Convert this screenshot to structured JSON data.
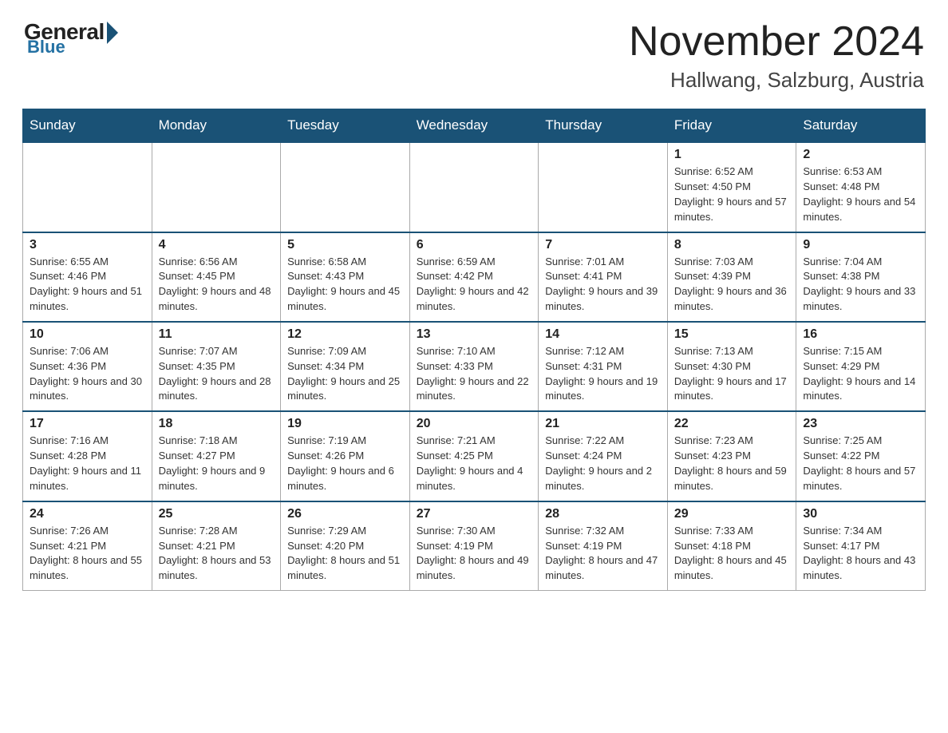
{
  "header": {
    "logo_general": "General",
    "logo_blue": "Blue",
    "main_title": "November 2024",
    "subtitle": "Hallwang, Salzburg, Austria"
  },
  "weekdays": [
    "Sunday",
    "Monday",
    "Tuesday",
    "Wednesday",
    "Thursday",
    "Friday",
    "Saturday"
  ],
  "weeks": [
    [
      {
        "day": "",
        "info": "",
        "empty": true
      },
      {
        "day": "",
        "info": "",
        "empty": true
      },
      {
        "day": "",
        "info": "",
        "empty": true
      },
      {
        "day": "",
        "info": "",
        "empty": true
      },
      {
        "day": "",
        "info": "",
        "empty": true
      },
      {
        "day": "1",
        "info": "Sunrise: 6:52 AM\nSunset: 4:50 PM\nDaylight: 9 hours and 57 minutes."
      },
      {
        "day": "2",
        "info": "Sunrise: 6:53 AM\nSunset: 4:48 PM\nDaylight: 9 hours and 54 minutes."
      }
    ],
    [
      {
        "day": "3",
        "info": "Sunrise: 6:55 AM\nSunset: 4:46 PM\nDaylight: 9 hours and 51 minutes."
      },
      {
        "day": "4",
        "info": "Sunrise: 6:56 AM\nSunset: 4:45 PM\nDaylight: 9 hours and 48 minutes."
      },
      {
        "day": "5",
        "info": "Sunrise: 6:58 AM\nSunset: 4:43 PM\nDaylight: 9 hours and 45 minutes."
      },
      {
        "day": "6",
        "info": "Sunrise: 6:59 AM\nSunset: 4:42 PM\nDaylight: 9 hours and 42 minutes."
      },
      {
        "day": "7",
        "info": "Sunrise: 7:01 AM\nSunset: 4:41 PM\nDaylight: 9 hours and 39 minutes."
      },
      {
        "day": "8",
        "info": "Sunrise: 7:03 AM\nSunset: 4:39 PM\nDaylight: 9 hours and 36 minutes."
      },
      {
        "day": "9",
        "info": "Sunrise: 7:04 AM\nSunset: 4:38 PM\nDaylight: 9 hours and 33 minutes."
      }
    ],
    [
      {
        "day": "10",
        "info": "Sunrise: 7:06 AM\nSunset: 4:36 PM\nDaylight: 9 hours and 30 minutes."
      },
      {
        "day": "11",
        "info": "Sunrise: 7:07 AM\nSunset: 4:35 PM\nDaylight: 9 hours and 28 minutes."
      },
      {
        "day": "12",
        "info": "Sunrise: 7:09 AM\nSunset: 4:34 PM\nDaylight: 9 hours and 25 minutes."
      },
      {
        "day": "13",
        "info": "Sunrise: 7:10 AM\nSunset: 4:33 PM\nDaylight: 9 hours and 22 minutes."
      },
      {
        "day": "14",
        "info": "Sunrise: 7:12 AM\nSunset: 4:31 PM\nDaylight: 9 hours and 19 minutes."
      },
      {
        "day": "15",
        "info": "Sunrise: 7:13 AM\nSunset: 4:30 PM\nDaylight: 9 hours and 17 minutes."
      },
      {
        "day": "16",
        "info": "Sunrise: 7:15 AM\nSunset: 4:29 PM\nDaylight: 9 hours and 14 minutes."
      }
    ],
    [
      {
        "day": "17",
        "info": "Sunrise: 7:16 AM\nSunset: 4:28 PM\nDaylight: 9 hours and 11 minutes."
      },
      {
        "day": "18",
        "info": "Sunrise: 7:18 AM\nSunset: 4:27 PM\nDaylight: 9 hours and 9 minutes."
      },
      {
        "day": "19",
        "info": "Sunrise: 7:19 AM\nSunset: 4:26 PM\nDaylight: 9 hours and 6 minutes."
      },
      {
        "day": "20",
        "info": "Sunrise: 7:21 AM\nSunset: 4:25 PM\nDaylight: 9 hours and 4 minutes."
      },
      {
        "day": "21",
        "info": "Sunrise: 7:22 AM\nSunset: 4:24 PM\nDaylight: 9 hours and 2 minutes."
      },
      {
        "day": "22",
        "info": "Sunrise: 7:23 AM\nSunset: 4:23 PM\nDaylight: 8 hours and 59 minutes."
      },
      {
        "day": "23",
        "info": "Sunrise: 7:25 AM\nSunset: 4:22 PM\nDaylight: 8 hours and 57 minutes."
      }
    ],
    [
      {
        "day": "24",
        "info": "Sunrise: 7:26 AM\nSunset: 4:21 PM\nDaylight: 8 hours and 55 minutes."
      },
      {
        "day": "25",
        "info": "Sunrise: 7:28 AM\nSunset: 4:21 PM\nDaylight: 8 hours and 53 minutes."
      },
      {
        "day": "26",
        "info": "Sunrise: 7:29 AM\nSunset: 4:20 PM\nDaylight: 8 hours and 51 minutes."
      },
      {
        "day": "27",
        "info": "Sunrise: 7:30 AM\nSunset: 4:19 PM\nDaylight: 8 hours and 49 minutes."
      },
      {
        "day": "28",
        "info": "Sunrise: 7:32 AM\nSunset: 4:19 PM\nDaylight: 8 hours and 47 minutes."
      },
      {
        "day": "29",
        "info": "Sunrise: 7:33 AM\nSunset: 4:18 PM\nDaylight: 8 hours and 45 minutes."
      },
      {
        "day": "30",
        "info": "Sunrise: 7:34 AM\nSunset: 4:17 PM\nDaylight: 8 hours and 43 minutes."
      }
    ]
  ]
}
